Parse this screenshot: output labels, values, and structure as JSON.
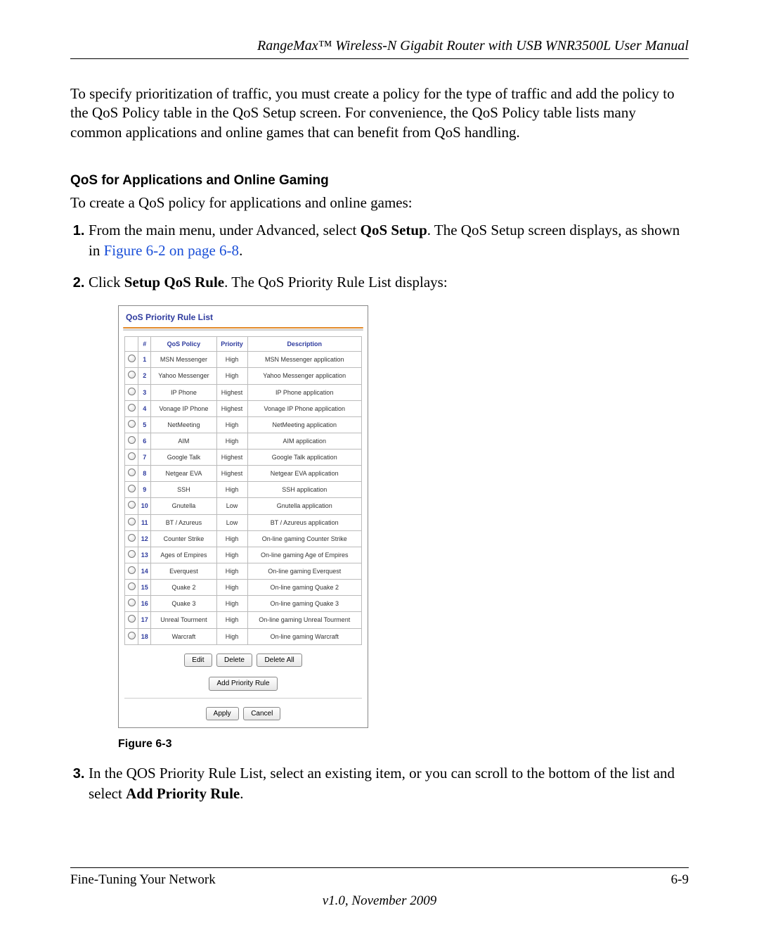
{
  "header": {
    "title": "RangeMax™ Wireless-N Gigabit Router with USB WNR3500L User Manual"
  },
  "intro": "To specify prioritization of traffic, you must create a policy for the type of traffic and add the policy to the QoS Policy table in the QoS Setup screen. For convenience, the QoS Policy table lists many common applications and online games that can benefit from QoS handling.",
  "subheading": "QoS for Applications and Online Gaming",
  "lead": "To create a QoS policy for applications and online games:",
  "steps": {
    "s1_pre": "From the main menu, under Advanced, select ",
    "s1_bold": "QoS Setup",
    "s1_mid": ". The QoS Setup screen displays, as shown in ",
    "s1_link": "Figure 6-2 on page 6-8",
    "s1_end": ".",
    "s2_pre": "Click ",
    "s2_bold": "Setup QoS Rule",
    "s2_end": ". The QoS Priority Rule List displays:",
    "s3_pre": "In the QOS Priority Rule List, select an existing item, or you can scroll to the bottom of the list and select ",
    "s3_bold": "Add Priority Rule",
    "s3_end": "."
  },
  "figure": {
    "panel_title": "QoS Priority Rule List",
    "headers": {
      "hash": "#",
      "policy": "QoS Policy",
      "priority": "Priority",
      "desc": "Description"
    },
    "rows": [
      {
        "n": "1",
        "policy": "MSN Messenger",
        "priority": "High",
        "desc": "MSN Messenger application"
      },
      {
        "n": "2",
        "policy": "Yahoo Messenger",
        "priority": "High",
        "desc": "Yahoo Messenger application"
      },
      {
        "n": "3",
        "policy": "IP Phone",
        "priority": "Highest",
        "desc": "IP Phone application"
      },
      {
        "n": "4",
        "policy": "Vonage IP Phone",
        "priority": "Highest",
        "desc": "Vonage IP Phone application"
      },
      {
        "n": "5",
        "policy": "NetMeeting",
        "priority": "High",
        "desc": "NetMeeting application"
      },
      {
        "n": "6",
        "policy": "AIM",
        "priority": "High",
        "desc": "AIM application"
      },
      {
        "n": "7",
        "policy": "Google Talk",
        "priority": "Highest",
        "desc": "Google Talk application"
      },
      {
        "n": "8",
        "policy": "Netgear EVA",
        "priority": "Highest",
        "desc": "Netgear EVA application"
      },
      {
        "n": "9",
        "policy": "SSH",
        "priority": "High",
        "desc": "SSH application"
      },
      {
        "n": "10",
        "policy": "Gnutella",
        "priority": "Low",
        "desc": "Gnutella application"
      },
      {
        "n": "11",
        "policy": "BT / Azureus",
        "priority": "Low",
        "desc": "BT / Azureus application"
      },
      {
        "n": "12",
        "policy": "Counter Strike",
        "priority": "High",
        "desc": "On-line gaming Counter Strike"
      },
      {
        "n": "13",
        "policy": "Ages of Empires",
        "priority": "High",
        "desc": "On-line gaming Age of Empires"
      },
      {
        "n": "14",
        "policy": "Everquest",
        "priority": "High",
        "desc": "On-line gaming Everquest"
      },
      {
        "n": "15",
        "policy": "Quake 2",
        "priority": "High",
        "desc": "On-line gaming Quake 2"
      },
      {
        "n": "16",
        "policy": "Quake 3",
        "priority": "High",
        "desc": "On-line gaming Quake 3"
      },
      {
        "n": "17",
        "policy": "Unreal Tourment",
        "priority": "High",
        "desc": "On-line gaming Unreal Tourment"
      },
      {
        "n": "18",
        "policy": "Warcraft",
        "priority": "High",
        "desc": "On-line gaming Warcraft"
      }
    ],
    "buttons": {
      "edit": "Edit",
      "delete": "Delete",
      "delete_all": "Delete All",
      "add": "Add Priority Rule",
      "apply": "Apply",
      "cancel": "Cancel"
    },
    "caption": "Figure 6-3"
  },
  "footer": {
    "section": "Fine-Tuning Your Network",
    "page": "6-9",
    "version": "v1.0, November 2009"
  }
}
